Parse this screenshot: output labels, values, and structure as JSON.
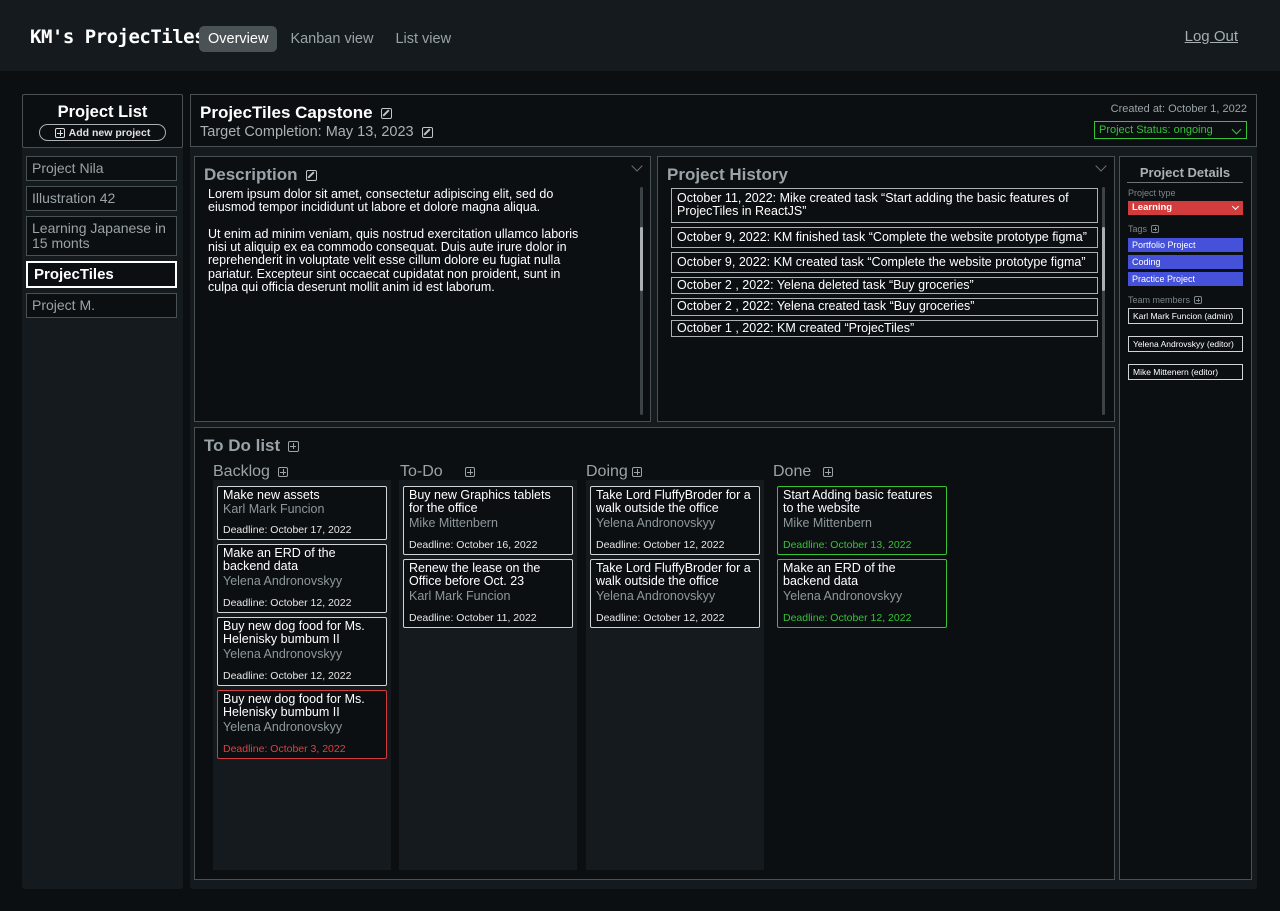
{
  "brand": "KM's ProjecTiles",
  "nav": {
    "overview": "Overview",
    "kanban": "Kanban view",
    "list": "List view",
    "logout": "Log Out"
  },
  "sidebar": {
    "title": "Project List",
    "add_label": "Add new project",
    "projects": [
      "Project Nila",
      "Illustration 42",
      "Learning Japanese in 15 monts",
      "ProjecTiles",
      "Project M."
    ]
  },
  "project": {
    "title": "ProjecTiles Capstone",
    "target": "Target Completion: May 13, 2023",
    "created": "Created at: October 1, 2022",
    "status": "Project Status: ongoing"
  },
  "description": {
    "title": "Description",
    "text": "Lorem ipsum dolor sit amet, consectetur adipiscing elit, sed do eiusmod tempor incididunt ut labore et dolore magna aliqua.\n\nUt enim ad minim veniam, quis nostrud exercitation ullamco laboris nisi ut aliquip ex ea commodo consequat. Duis aute irure dolor in reprehenderit in voluptate velit esse cillum dolore eu fugiat nulla pariatur. Excepteur sint occaecat cupidatat non proident, sunt in culpa qui officia deserunt mollit anim id est laborum."
  },
  "history": {
    "title": "Project History",
    "items": [
      "October 11, 2022: Mike created task “Start adding the basic features of ProjecTiles in ReactJS”",
      "October 9, 2022: KM finished task “Complete the website prototype figma”",
      "October 9, 2022: KM created task “Complete the website prototype figma”",
      "October 2 , 2022: Yelena deleted task “Buy groceries”",
      "October 2 , 2022: Yelena created task “Buy groceries”",
      "October 1 , 2022: KM created “ProjecTiles”"
    ]
  },
  "details": {
    "title": "Project Details",
    "type_label": "Project type",
    "type_value": "Learning",
    "tags_label": "Tags",
    "tags": [
      "Portfolio Project",
      "Coding",
      "Practice Project"
    ],
    "members_label": "Team members",
    "members": [
      "Karl Mark Funcion (admin)",
      "Yelena Androvskyy (editor)",
      "Mike Mittenern (editor)"
    ],
    "colors": {
      "type": "#d23c3c",
      "tag": "#4451d8"
    }
  },
  "todo": {
    "title": "To Do list",
    "columns": {
      "backlog": {
        "title": "Backlog",
        "cards": [
          {
            "title": "Make new assets",
            "person": "Karl Mark Funcion",
            "deadline": "Deadline: October 17, 2022",
            "state": "normal"
          },
          {
            "title": "Make an ERD of the backend data",
            "person": "Yelena Andronovskyy",
            "deadline": "Deadline: October 12, 2022",
            "state": "normal"
          },
          {
            "title": "Buy new dog food for Ms. Helenisky bumbum II",
            "person": "Yelena Andronovskyy",
            "deadline": "Deadline: October 12, 2022",
            "state": "normal"
          },
          {
            "title": "Buy new dog food for Ms. Helenisky bumbum II",
            "person": "Yelena Andronovskyy",
            "deadline": "Deadline: October 3, 2022",
            "state": "overdue"
          }
        ]
      },
      "todo": {
        "title": "To-Do",
        "cards": [
          {
            "title": "Buy new Graphics tablets for the office",
            "person": "Mike Mittenbern",
            "deadline": "Deadline: October 16, 2022",
            "state": "normal"
          },
          {
            "title": "Renew the lease on the Office before Oct. 23",
            "person": "Karl Mark Funcion",
            "deadline": "Deadline: October 11, 2022",
            "state": "normal"
          }
        ]
      },
      "doing": {
        "title": "Doing",
        "cards": [
          {
            "title": "Take Lord FluffyBroder for a walk outside the office",
            "person": "Yelena Andronovskyy",
            "deadline": "Deadline: October 12, 2022",
            "state": "normal"
          },
          {
            "title": "Take Lord FluffyBroder for a walk outside the office",
            "person": "Yelena Andronovskyy",
            "deadline": "Deadline: October 12, 2022",
            "state": "normal"
          }
        ]
      },
      "done": {
        "title": "Done",
        "cards": [
          {
            "title": "Start Adding basic features to the website",
            "person": "Mike Mittenbern",
            "deadline": "Deadline: October 13, 2022",
            "state": "done"
          },
          {
            "title": "Make an ERD of the backend data",
            "person": "Yelena Andronovskyy",
            "deadline": "Deadline: October 12, 2022",
            "state": "done"
          }
        ]
      }
    }
  }
}
